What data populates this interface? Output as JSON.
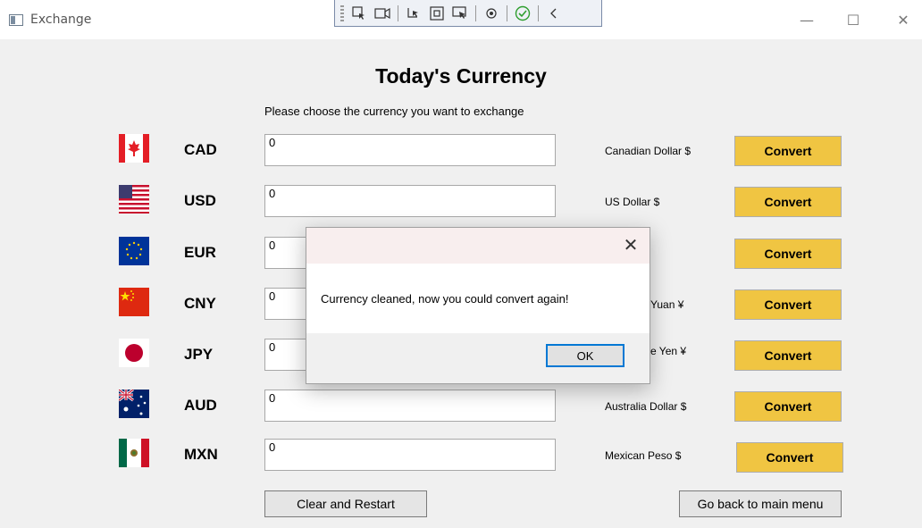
{
  "window": {
    "title": "Exchange",
    "minimize_glyph": "—",
    "maximize_glyph": "☐",
    "close_glyph": "✕"
  },
  "debug_toolbar": {
    "icons": [
      "select-element-icon",
      "record-icon",
      "pointer-icon",
      "frame-icon",
      "track-focus-icon",
      "hot-reload-icon",
      "check-icon",
      "collapse-icon"
    ]
  },
  "main": {
    "heading": "Today's Currency",
    "subtitle": "Please choose the currency you want to exchange",
    "currencies": [
      {
        "code": "CAD",
        "amount": "0",
        "name": "Canadian Dollar $",
        "convert_label": "Convert",
        "flag": "canada-flag-icon"
      },
      {
        "code": "USD",
        "amount": "0",
        "name": "US Dollar $",
        "convert_label": "Convert",
        "flag": "usa-flag-icon"
      },
      {
        "code": "EUR",
        "amount": "0",
        "name": "",
        "convert_label": "Convert",
        "flag": "eu-flag-icon"
      },
      {
        "code": "CNY",
        "amount": "0",
        "name": "Yuan ¥",
        "convert_label": "Convert",
        "flag": "china-flag-icon"
      },
      {
        "code": "JPY",
        "amount": "0",
        "name": "e Yen ¥",
        "convert_label": "Convert",
        "flag": "japan-flag-icon"
      },
      {
        "code": "AUD",
        "amount": "0",
        "name": "Australia Dollar $",
        "convert_label": "Convert",
        "flag": "australia-flag-icon"
      },
      {
        "code": "MXN",
        "amount": "0",
        "name": "Mexican Peso $",
        "convert_label": "Convert",
        "flag": "mexico-flag-icon"
      }
    ],
    "clear_label": "Clear and Restart",
    "back_label": "Go back to main menu"
  },
  "dialog": {
    "message": "Currency cleaned, now you could convert again!",
    "ok_label": "OK",
    "close_glyph": "✕"
  },
  "colors": {
    "convert_button": "#f0c542",
    "window_bg": "#f0f0f0",
    "dialog_title_bg": "#f8eeee",
    "focus_border": "#0078d4"
  }
}
